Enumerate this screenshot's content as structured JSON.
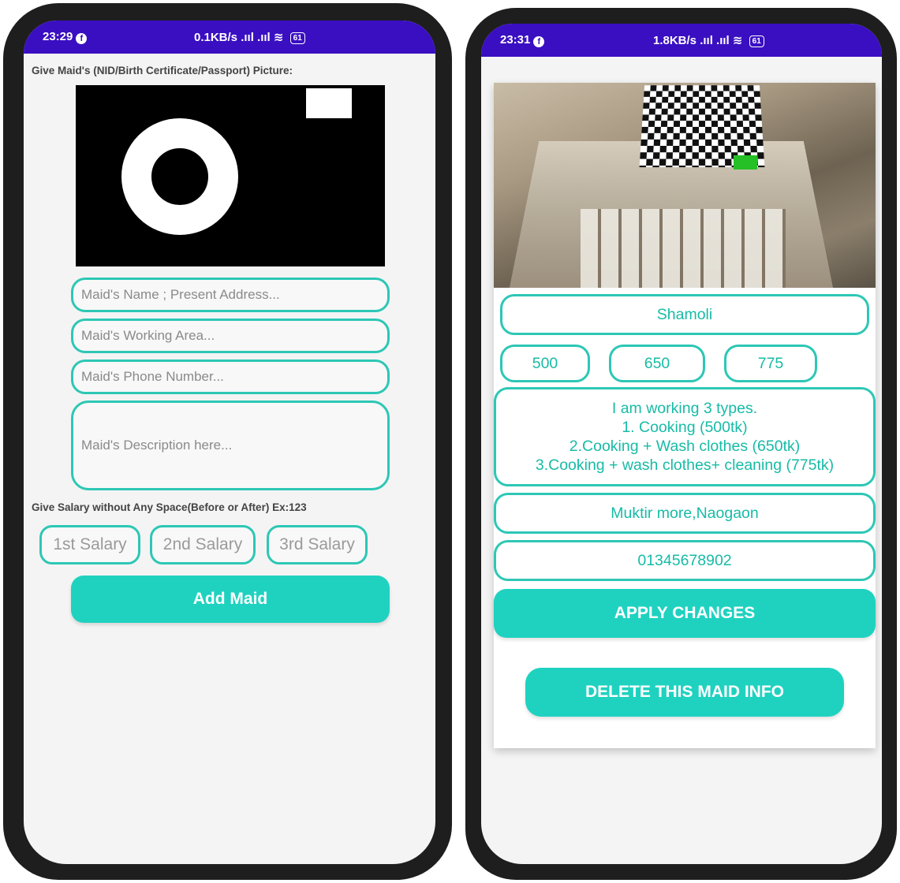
{
  "left_screen": {
    "status": {
      "time": "23:29",
      "speed": "0.1KB/s",
      "signal": ".ııl .ııl",
      "battery": "61"
    },
    "picture_prompt": "Give Maid's (NID/Birth Certificate/Passport) Picture:",
    "camera_icon": "camera-icon",
    "name_placeholder": "Maid's Name ; Present Address...",
    "area_placeholder": "Maid's Working Area...",
    "phone_placeholder": "Maid's Phone Number...",
    "description_placeholder": "Maid's Description here...",
    "salary_prompt": "Give Salary without Any Space(Before or After) Ex:123",
    "salary1_placeholder": "1st Salary",
    "salary2_placeholder": "2nd Salary",
    "salary3_placeholder": "3rd Salary",
    "add_button": "Add Maid"
  },
  "right_screen": {
    "status": {
      "time": "23:31",
      "speed": "1.8KB/s",
      "signal": ".ııl .ııl",
      "battery": "61"
    },
    "area": "Shamoli",
    "salary1": "500",
    "salary2": "650",
    "salary3": "775",
    "description_lines": [
      "I am working 3 types.",
      "1. Cooking (500tk)",
      "2.Cooking + Wash clothes (650tk)",
      "3.Cooking + wash clothes+ cleaning (775tk)"
    ],
    "address": "Muktir more,Naogaon",
    "phone": "01345678902",
    "apply_button": "APPLY CHANGES",
    "delete_button": "DELETE THIS MAID INFO"
  },
  "colors": {
    "accent": "#1fd2c0",
    "border": "#2dc7b5",
    "status_bar": "#3a0fc2",
    "text_teal": "#17bba6"
  }
}
